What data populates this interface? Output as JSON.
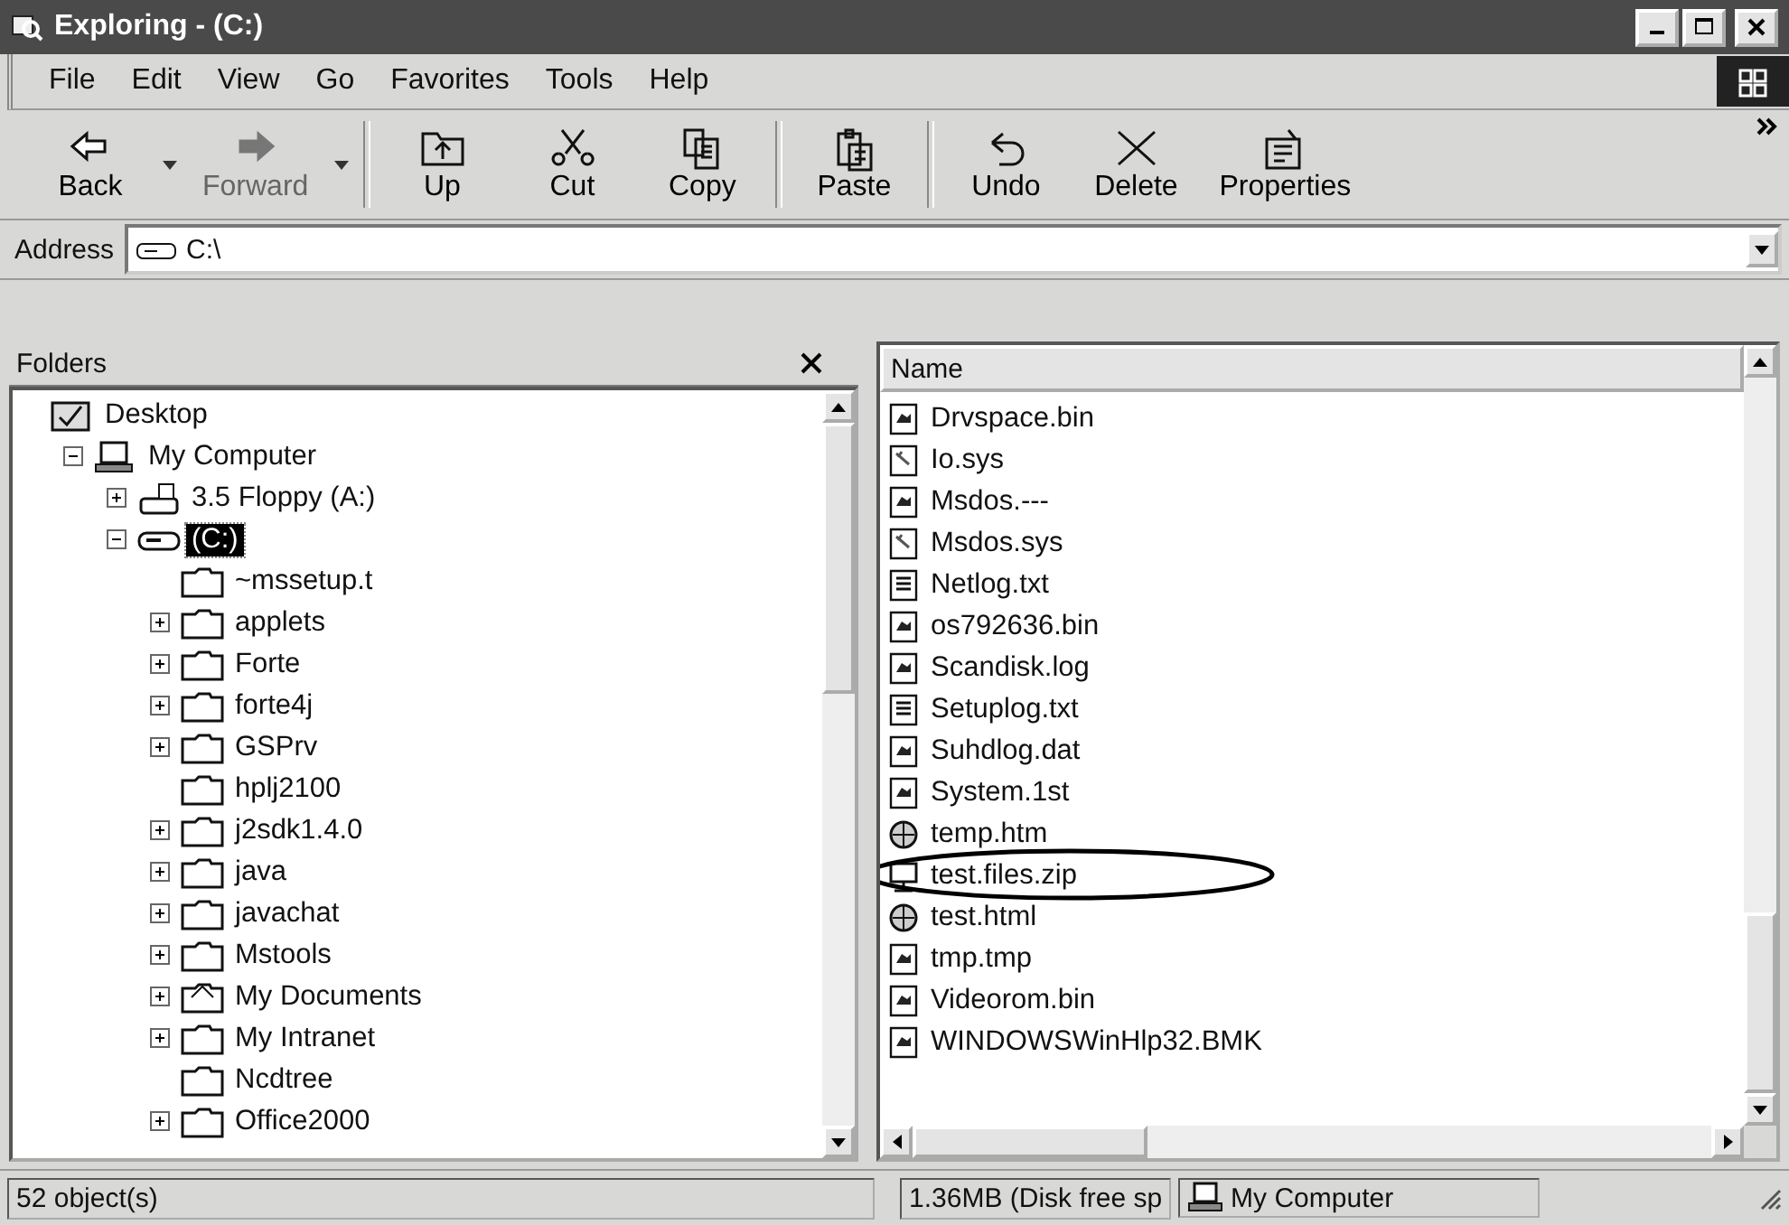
{
  "window": {
    "title": "Exploring -  (C:)"
  },
  "menu": [
    "File",
    "Edit",
    "View",
    "Go",
    "Favorites",
    "Tools",
    "Help"
  ],
  "toolbar": [
    {
      "label": "Back",
      "kind": "back",
      "disabled": false,
      "dropdown": true
    },
    {
      "label": "Forward",
      "kind": "forward",
      "disabled": true,
      "dropdown": true
    },
    {
      "label": "Up",
      "kind": "up",
      "disabled": false,
      "dropdown": false
    },
    {
      "label": "Cut",
      "kind": "cut",
      "disabled": false,
      "dropdown": false
    },
    {
      "label": "Copy",
      "kind": "copy",
      "disabled": false,
      "dropdown": false
    },
    {
      "label": "Paste",
      "kind": "paste",
      "disabled": false,
      "dropdown": false
    },
    {
      "label": "Undo",
      "kind": "undo",
      "disabled": false,
      "dropdown": false
    },
    {
      "label": "Delete",
      "kind": "delete",
      "disabled": false,
      "dropdown": false
    },
    {
      "label": "Properties",
      "kind": "properties",
      "disabled": false,
      "dropdown": false
    }
  ],
  "address": {
    "label": "Address",
    "value": "C:\\"
  },
  "folders": {
    "title": "Folders",
    "tree": [
      {
        "label": "Desktop",
        "kind": "desktop",
        "expandable": false,
        "expanded": true,
        "selected": false,
        "children": [
          {
            "label": "My Computer",
            "kind": "computer",
            "expandable": true,
            "expanded": true,
            "selected": false,
            "children": [
              {
                "label": "3.5 Floppy (A:)",
                "kind": "floppy",
                "expandable": true,
                "expanded": false,
                "selected": false
              },
              {
                "label": "(C:)",
                "kind": "drive",
                "expandable": true,
                "expanded": true,
                "selected": true,
                "children": [
                  {
                    "label": "~mssetup.t",
                    "kind": "folder",
                    "expandable": false,
                    "expanded": false,
                    "selected": false
                  },
                  {
                    "label": "applets",
                    "kind": "folder",
                    "expandable": true,
                    "expanded": false,
                    "selected": false
                  },
                  {
                    "label": "Forte",
                    "kind": "folder",
                    "expandable": true,
                    "expanded": false,
                    "selected": false
                  },
                  {
                    "label": "forte4j",
                    "kind": "folder",
                    "expandable": true,
                    "expanded": false,
                    "selected": false
                  },
                  {
                    "label": "GSPrv",
                    "kind": "folder",
                    "expandable": true,
                    "expanded": false,
                    "selected": false
                  },
                  {
                    "label": "hplj2100",
                    "kind": "folder",
                    "expandable": false,
                    "expanded": false,
                    "selected": false
                  },
                  {
                    "label": "j2sdk1.4.0",
                    "kind": "folder",
                    "expandable": true,
                    "expanded": false,
                    "selected": false
                  },
                  {
                    "label": "java",
                    "kind": "folder",
                    "expandable": true,
                    "expanded": false,
                    "selected": false
                  },
                  {
                    "label": "javachat",
                    "kind": "folder",
                    "expandable": true,
                    "expanded": false,
                    "selected": false
                  },
                  {
                    "label": "Mstools",
                    "kind": "folder",
                    "expandable": true,
                    "expanded": false,
                    "selected": false
                  },
                  {
                    "label": "My Documents",
                    "kind": "documents",
                    "expandable": true,
                    "expanded": false,
                    "selected": false
                  },
                  {
                    "label": "My Intranet",
                    "kind": "folder",
                    "expandable": true,
                    "expanded": false,
                    "selected": false
                  },
                  {
                    "label": "Ncdtree",
                    "kind": "folder",
                    "expandable": false,
                    "expanded": false,
                    "selected": false
                  },
                  {
                    "label": "Office2000",
                    "kind": "folder",
                    "expandable": true,
                    "expanded": false,
                    "selected": false
                  }
                ]
              }
            ]
          }
        ]
      }
    ]
  },
  "files": {
    "column": "Name",
    "items": [
      {
        "name": "Drvspace.bin",
        "kind": "system",
        "circled": false
      },
      {
        "name": "Io.sys",
        "kind": "sys",
        "circled": false
      },
      {
        "name": "Msdos.---",
        "kind": "system",
        "circled": false
      },
      {
        "name": "Msdos.sys",
        "kind": "sys",
        "circled": false
      },
      {
        "name": "Netlog.txt",
        "kind": "text",
        "circled": false
      },
      {
        "name": "os792636.bin",
        "kind": "system",
        "circled": false
      },
      {
        "name": "Scandisk.log",
        "kind": "system",
        "circled": false
      },
      {
        "name": "Setuplog.txt",
        "kind": "text",
        "circled": false
      },
      {
        "name": "Suhdlog.dat",
        "kind": "system",
        "circled": false
      },
      {
        "name": "System.1st",
        "kind": "system",
        "circled": false
      },
      {
        "name": "temp.htm",
        "kind": "html",
        "circled": false
      },
      {
        "name": "test.files.zip",
        "kind": "zip",
        "circled": true
      },
      {
        "name": "test.html",
        "kind": "html",
        "circled": false
      },
      {
        "name": "tmp.tmp",
        "kind": "system",
        "circled": false
      },
      {
        "name": "Videorom.bin",
        "kind": "system",
        "circled": false
      },
      {
        "name": "WINDOWSWinHlp32.BMK",
        "kind": "system",
        "circled": false
      }
    ]
  },
  "status_bar": {
    "objects": "52 object(s)",
    "disk": "1.36MB (Disk free sp",
    "location": "My Computer"
  }
}
